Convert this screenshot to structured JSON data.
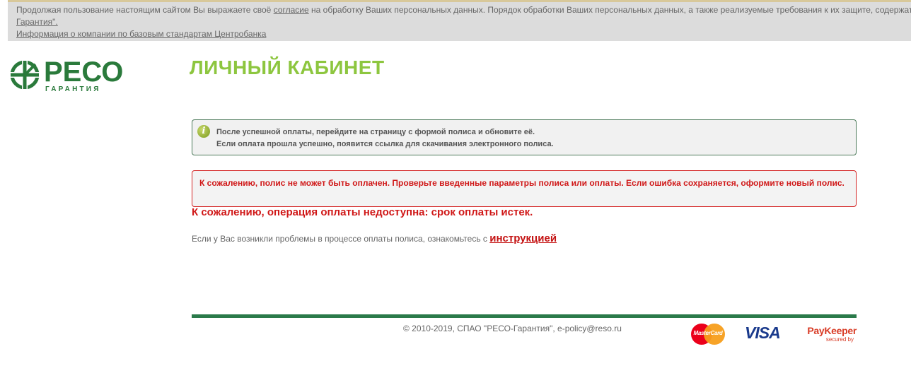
{
  "cookie_notice": {
    "text_before_link": "Продолжая пользование настоящим сайтом Вы выражаете своё ",
    "consent_link": "согласие",
    "text_after_link": " на обработку Ваших персональных данных. Порядок обработки Ваших персональных данных, а также реализуемые требования к их защите, содержатся в Политике СПАО \"РЕСО-",
    "line2": "Гарантия\".",
    "company_info_link": "Информация о компании по базовым стандартам Центробанка"
  },
  "logo": {
    "name": "РЕСО",
    "subtitle": "ГАРАНТИЯ",
    "color": "#2a7a3b"
  },
  "page_title": "ЛИЧНЫЙ КАБИНЕТ",
  "info_message": {
    "icon": "info-icon",
    "line1": "После успешной оплаты, перейдите на страницу с формой полиса и обновите её.",
    "line2": "Если оплата прошла успешно, появится ссылка для скачивания электронного полиса."
  },
  "error_message": {
    "text": "К сожалению, полис не может быть оплачен. Проверьте введенные параметры полиса или оплаты. Если ошибка сохраняется, оформите новый полис.",
    "color": "#d01818"
  },
  "expired_message": "К сожалению, операция оплаты недоступна: срок оплаты истек.",
  "help": {
    "text": "Если у Вас возникли проблемы в процессе оплаты полиса, ознакомьтесь с ",
    "link": "инструкцией"
  },
  "footer": {
    "copyright": "© 2010-2019, СПАО \"РЕСО-Гарантия\", e-policy@reso.ru",
    "payment_logos": {
      "mastercard": "MasterCard",
      "visa": "VISA",
      "paykeeper": "PayKeeper",
      "paykeeper_sub": "secured by"
    }
  },
  "colors": {
    "accent_green": "#8dc63f",
    "footer_bar": "#2a7a4a",
    "error_red": "#d01818"
  }
}
